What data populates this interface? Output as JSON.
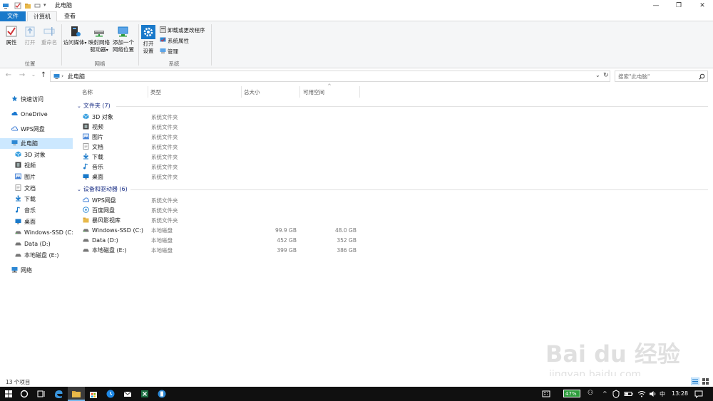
{
  "window": {
    "title": "此电脑",
    "minimize": "—",
    "maximize": "❐",
    "close": "✕"
  },
  "ribbon_tabs": {
    "file": "文件",
    "computer": "计算机",
    "view": "查看"
  },
  "ribbon": {
    "location": {
      "label": "位置",
      "properties": "属性",
      "open": "打开",
      "rename": "重命名"
    },
    "network": {
      "label": "网络",
      "access_media": "访问媒体",
      "map_drive_1": "映射网络",
      "map_drive_2": "驱动器",
      "add_location_1": "添加一个",
      "add_location_2": "网络位置"
    },
    "system": {
      "label": "系统",
      "open_settings_1": "打开",
      "open_settings_2": "设置",
      "uninstall": "卸载或更改程序",
      "system_properties": "系统属性",
      "manage": "管理"
    }
  },
  "navigation": {
    "back": "←",
    "forward": "→",
    "recent": "⌄",
    "up": "↑",
    "breadcrumb": "此电脑",
    "dropdown": "⌄",
    "refresh": "↻"
  },
  "search": {
    "placeholder": "搜索\"此电脑\""
  },
  "nav_pane": [
    {
      "label": "快速访问",
      "icon": "star-icon",
      "color": "#1979ca"
    },
    {
      "label": "OneDrive",
      "icon": "cloud-icon",
      "color": "#1b78d0"
    },
    {
      "label": "WPS网盘",
      "icon": "cloud-outline-icon",
      "color": "#3a7bd5"
    },
    {
      "label": "此电脑",
      "icon": "computer-icon",
      "color": "#2d88d4"
    },
    {
      "label": "3D 对象",
      "icon": "cube-icon",
      "color": "#3aa0e0"
    },
    {
      "label": "视频",
      "icon": "film-icon",
      "color": "#444"
    },
    {
      "label": "图片",
      "icon": "picture-icon",
      "color": "#3a7bd5"
    },
    {
      "label": "文档",
      "icon": "document-icon",
      "color": "#888"
    },
    {
      "label": "下载",
      "icon": "download-icon",
      "color": "#1979ca"
    },
    {
      "label": "音乐",
      "icon": "music-icon",
      "color": "#1979ca"
    },
    {
      "label": "桌面",
      "icon": "desktop-icon",
      "color": "#1979ca"
    },
    {
      "label": "Windows-SSD (C:)",
      "icon": "drive-icon",
      "color": "#666"
    },
    {
      "label": "Data (D:)",
      "icon": "drive-icon",
      "color": "#666"
    },
    {
      "label": "本地磁盘 (E:)",
      "icon": "drive-icon",
      "color": "#666"
    },
    {
      "label": "网络",
      "icon": "network-icon",
      "color": "#2d88d4"
    }
  ],
  "columns": {
    "name": "名称",
    "type": "类型",
    "total": "总大小",
    "free": "可用空间",
    "sort_indicator": "^"
  },
  "groups": {
    "folders": "文件夹 (7)",
    "devices": "设备和驱动器 (6)",
    "collapse": "⌄"
  },
  "folders": [
    {
      "name": "3D 对象",
      "type": "系统文件夹",
      "icon": "cube-icon",
      "color": "#3aa0e0"
    },
    {
      "name": "视频",
      "type": "系统文件夹",
      "icon": "film-icon",
      "color": "#444"
    },
    {
      "name": "图片",
      "type": "系统文件夹",
      "icon": "picture-icon",
      "color": "#3a7bd5"
    },
    {
      "name": "文档",
      "type": "系统文件夹",
      "icon": "document-icon",
      "color": "#888"
    },
    {
      "name": "下载",
      "type": "系统文件夹",
      "icon": "download-icon",
      "color": "#1979ca"
    },
    {
      "name": "音乐",
      "type": "系统文件夹",
      "icon": "music-icon",
      "color": "#1979ca"
    },
    {
      "name": "桌面",
      "type": "系统文件夹",
      "icon": "desktop-icon",
      "color": "#1979ca"
    }
  ],
  "devices": [
    {
      "name": "WPS网盘",
      "type": "系统文件夹",
      "total": "",
      "free": "",
      "icon": "cloud-outline-icon",
      "color": "#3a7bd5"
    },
    {
      "name": "百度网盘",
      "type": "系统文件夹",
      "total": "",
      "free": "",
      "icon": "baidu-pan-icon",
      "color": "#2d88d4"
    },
    {
      "name": "暴风影视库",
      "type": "系统文件夹",
      "total": "",
      "free": "",
      "icon": "folder-icon",
      "color": "#e8b94a"
    },
    {
      "name": "Windows-SSD (C:)",
      "type": "本地磁盘",
      "total": "99.9 GB",
      "free": "48.0 GB",
      "icon": "drive-icon",
      "color": "#666"
    },
    {
      "name": "Data (D:)",
      "type": "本地磁盘",
      "total": "452 GB",
      "free": "352 GB",
      "icon": "drive-icon",
      "color": "#666"
    },
    {
      "name": "本地磁盘 (E:)",
      "type": "本地磁盘",
      "total": "399 GB",
      "free": "386 GB",
      "icon": "drive-icon",
      "color": "#666"
    }
  ],
  "status": {
    "item_count": "13 个项目"
  },
  "taskbar": {
    "battery": "47%",
    "ime": "中",
    "time": "13:28"
  },
  "watermark": {
    "text": "Bai du 经验",
    "url": "jingyan.baidu.com"
  },
  "colors": {
    "accent": "#1979ca",
    "selection": "#cce8ff",
    "group_header": "#1e3287"
  }
}
